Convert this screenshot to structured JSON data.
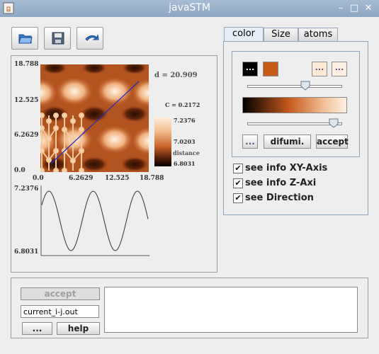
{
  "window": {
    "title": "javaSTM",
    "min": "–",
    "max": "□",
    "close": "✕"
  },
  "toolbar": {
    "open_icon": "folder-open-icon",
    "save_icon": "floppy-save-icon",
    "refresh_icon": "refresh-arrow-icon"
  },
  "image": {
    "y_ticks": [
      "18.788",
      "12.525",
      "6.2629",
      "0.0"
    ],
    "x_ticks": [
      "0.0",
      "6.2629",
      "12.525",
      "18.788"
    ],
    "distance": "d = 20.909",
    "c_value": "C = 0.2172",
    "scale_labels": [
      "7.2376",
      "7.0203",
      "6.8031"
    ],
    "scale_title": "distance",
    "profile_top": "7.2376",
    "profile_bottom": "6.8031"
  },
  "tabs": [
    "color",
    "Size",
    "atoms"
  ],
  "color_panel": {
    "swatch_labels": [
      "...",
      "",
      "...",
      "..."
    ],
    "swatch_colors": [
      "#000000",
      "#c85a1c",
      "#fde9d6",
      "#fdf0e2"
    ],
    "slider1_value": 0.6,
    "slider2_value": 0.95,
    "buttons": [
      "...",
      "difumi.",
      "accept"
    ]
  },
  "options": [
    "see info XY-Axis",
    "see info Z-Axi",
    "see Direction"
  ],
  "bottom": {
    "accept": "accept",
    "file_value": "current_i-j.out",
    "dots": "...",
    "help": "help",
    "text_area": ""
  }
}
